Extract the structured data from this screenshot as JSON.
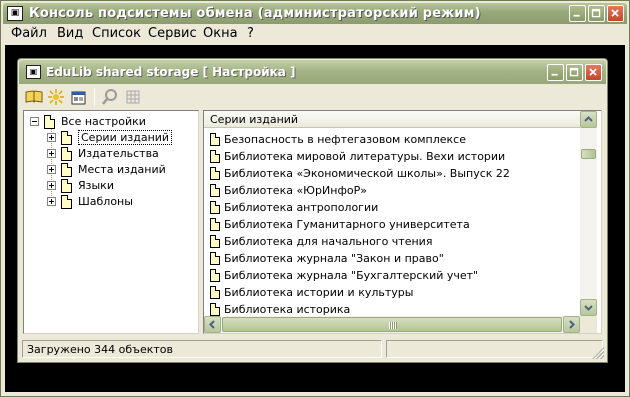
{
  "outer_window": {
    "title": "Консоль подсистемы обмена (администраторский режим)",
    "icon": "app-icon"
  },
  "menu": [
    {
      "label": "Файл"
    },
    {
      "label": "Вид"
    },
    {
      "label": "Список"
    },
    {
      "label": "Сервис"
    },
    {
      "label": "Окна"
    },
    {
      "label": "?"
    }
  ],
  "inner_window": {
    "title": "EduLib shared storage [ Настройка ]",
    "toolbar": [
      "open-book-icon",
      "settings-burst-icon",
      "properties-icon",
      "search-icon",
      "grid-icon"
    ]
  },
  "tree": {
    "root": "Все настройки",
    "children": [
      {
        "label": "Серии изданий",
        "selected": true
      },
      {
        "label": "Издательства"
      },
      {
        "label": "Места изданий"
      },
      {
        "label": "Языки"
      },
      {
        "label": "Шаблоны"
      }
    ]
  },
  "list": {
    "header": "Серии изданий",
    "items": [
      "Безопасность в нефтегазовом комплексе",
      "Библиотека  мировой литературы. Вехи истории",
      "Библиотека «Экономической школы». Выпуск   22",
      "Библиотека «ЮрИнфоР»",
      "Библиотека антропологии",
      "Библиотека Гуманитарного университета",
      "Библиотека для начального чтения",
      "Библиотека журнала  \"Закон и право\"",
      "Библиотека журнала \"Бухгалтерский учет\"",
      "Библиотека истории и культуры",
      "Библиотека историка"
    ]
  },
  "status": {
    "text": "Загружено 344 объектов"
  },
  "colors": {
    "title_bar": "#98a979",
    "window_bg": "#ece9d8",
    "desktop": "#000000"
  }
}
